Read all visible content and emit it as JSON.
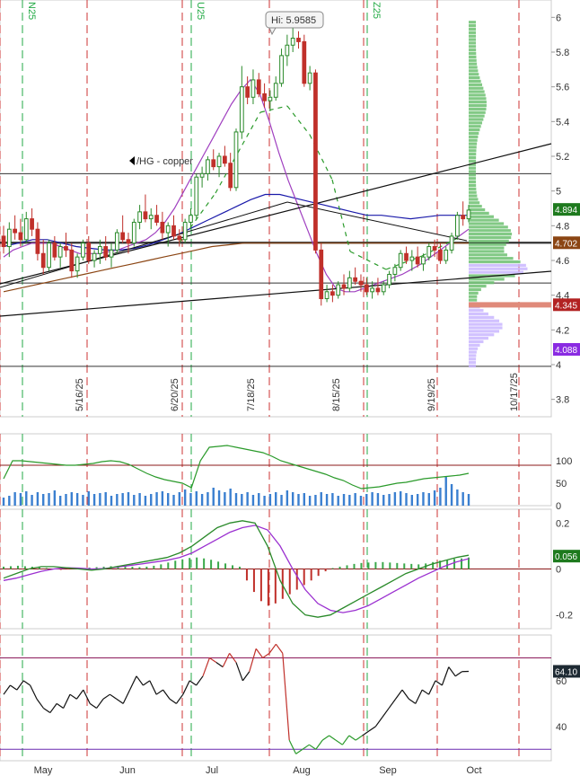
{
  "chart_data": {
    "type": "candlestick",
    "annotation_symbol": "/HG - copper",
    "hi_label": "Hi: 5.9585",
    "month_labels": [
      "May",
      "Jun",
      "Jul",
      "Aug",
      "Sep",
      "Oct"
    ],
    "date_labels": [
      "5/16/25",
      "6/20/25",
      "7/18/25",
      "8/15/25",
      "9/19/25",
      "10/17/25"
    ],
    "expiry_labels": [
      "N25",
      "U25",
      "Z25"
    ],
    "price_panel": {
      "ylim": [
        3.7,
        6.1
      ],
      "ticks": [
        "6",
        "5.8",
        "5.6",
        "5.4",
        "5.2",
        "5",
        "4.8",
        "4.6",
        "4.4",
        "4.2",
        "4",
        "3.8"
      ],
      "tick_values": [
        6,
        5.8,
        5.6,
        5.4,
        5.2,
        5,
        4.8,
        4.6,
        4.4,
        4.2,
        4,
        3.8
      ],
      "horizontal_lines": [
        5.1,
        4.702,
        4.47,
        3.99
      ],
      "badges": [
        {
          "label": "4.894",
          "value": 4.894,
          "color": "#1e7a1e"
        },
        {
          "label": "4.702",
          "value": 4.702,
          "color": "#8b4513"
        },
        {
          "label": "4.345",
          "value": 4.345,
          "color": "#b22222"
        },
        {
          "label": "4.088",
          "value": 4.088,
          "color": "#8a2be2"
        }
      ],
      "candles_ohlc": [
        [
          4.74,
          4.8,
          4.64,
          4.68
        ],
        [
          4.68,
          4.82,
          4.62,
          4.78
        ],
        [
          4.78,
          4.86,
          4.72,
          4.76
        ],
        [
          4.76,
          4.84,
          4.68,
          4.72
        ],
        [
          4.72,
          4.88,
          4.7,
          4.84
        ],
        [
          4.84,
          4.9,
          4.74,
          4.78
        ],
        [
          4.78,
          4.82,
          4.6,
          4.64
        ],
        [
          4.64,
          4.72,
          4.52,
          4.56
        ],
        [
          4.56,
          4.72,
          4.54,
          4.7
        ],
        [
          4.7,
          4.74,
          4.6,
          4.62
        ],
        [
          4.62,
          4.7,
          4.56,
          4.68
        ],
        [
          4.68,
          4.76,
          4.62,
          4.66
        ],
        [
          4.66,
          4.7,
          4.5,
          4.54
        ],
        [
          4.54,
          4.64,
          4.5,
          4.62
        ],
        [
          4.62,
          4.72,
          4.6,
          4.7
        ],
        [
          4.7,
          4.74,
          4.58,
          4.6
        ],
        [
          4.6,
          4.66,
          4.56,
          4.64
        ],
        [
          4.64,
          4.72,
          4.58,
          4.68
        ],
        [
          4.68,
          4.74,
          4.6,
          4.62
        ],
        [
          4.62,
          4.7,
          4.56,
          4.66
        ],
        [
          4.66,
          4.78,
          4.64,
          4.76
        ],
        [
          4.76,
          4.86,
          4.7,
          4.72
        ],
        [
          4.72,
          4.76,
          4.64,
          4.7
        ],
        [
          4.7,
          4.84,
          4.68,
          4.82
        ],
        [
          4.82,
          4.92,
          4.78,
          4.88
        ],
        [
          4.88,
          4.98,
          4.82,
          4.84
        ],
        [
          4.84,
          4.9,
          4.78,
          4.86
        ],
        [
          4.86,
          4.92,
          4.8,
          4.82
        ],
        [
          4.82,
          4.88,
          4.72,
          4.76
        ],
        [
          4.76,
          4.82,
          4.68,
          4.8
        ],
        [
          4.8,
          4.86,
          4.72,
          4.74
        ],
        [
          4.74,
          4.78,
          4.68,
          4.72
        ],
        [
          4.72,
          4.84,
          4.7,
          4.82
        ],
        [
          4.82,
          4.9,
          4.78,
          4.86
        ],
        [
          4.86,
          5.1,
          4.84,
          5.08
        ],
        [
          5.08,
          5.14,
          5.02,
          5.1
        ],
        [
          5.1,
          5.2,
          5.06,
          5.18
        ],
        [
          5.18,
          5.24,
          5.12,
          5.14
        ],
        [
          5.14,
          5.22,
          5.08,
          5.2
        ],
        [
          5.2,
          5.26,
          5.14,
          5.16
        ],
        [
          5.16,
          5.22,
          5.0,
          5.02
        ],
        [
          5.02,
          5.36,
          5.0,
          5.34
        ],
        [
          5.34,
          5.72,
          5.3,
          5.6
        ],
        [
          5.6,
          5.66,
          5.5,
          5.54
        ],
        [
          5.54,
          5.7,
          5.5,
          5.64
        ],
        [
          5.64,
          5.68,
          5.54,
          5.56
        ],
        [
          5.56,
          5.62,
          5.48,
          5.52
        ],
        [
          5.52,
          5.58,
          5.46,
          5.54
        ],
        [
          5.54,
          5.66,
          5.52,
          5.62
        ],
        [
          5.62,
          5.82,
          5.6,
          5.78
        ],
        [
          5.78,
          5.9,
          5.72,
          5.84
        ],
        [
          5.84,
          5.96,
          5.8,
          5.88
        ],
        [
          5.88,
          5.92,
          5.82,
          5.86
        ],
        [
          5.86,
          5.9,
          5.6,
          5.62
        ],
        [
          5.62,
          5.72,
          5.58,
          5.68
        ],
        [
          5.68,
          5.7,
          4.64,
          4.66
        ],
        [
          4.66,
          4.7,
          4.34,
          4.38
        ],
        [
          4.38,
          4.46,
          4.36,
          4.42
        ],
        [
          4.42,
          4.46,
          4.36,
          4.4
        ],
        [
          4.4,
          4.48,
          4.38,
          4.46
        ],
        [
          4.46,
          4.52,
          4.4,
          4.44
        ],
        [
          4.44,
          4.54,
          4.42,
          4.5
        ],
        [
          4.5,
          4.56,
          4.46,
          4.48
        ],
        [
          4.48,
          4.52,
          4.42,
          4.46
        ],
        [
          4.46,
          4.5,
          4.4,
          4.42
        ],
        [
          4.42,
          4.48,
          4.38,
          4.44
        ],
        [
          4.44,
          4.5,
          4.4,
          4.42
        ],
        [
          4.42,
          4.48,
          4.4,
          4.46
        ],
        [
          4.46,
          4.54,
          4.44,
          4.52
        ],
        [
          4.52,
          4.58,
          4.48,
          4.56
        ],
        [
          4.56,
          4.66,
          4.54,
          4.64
        ],
        [
          4.64,
          4.68,
          4.58,
          4.6
        ],
        [
          4.6,
          4.66,
          4.54,
          4.62
        ],
        [
          4.62,
          4.68,
          4.56,
          4.58
        ],
        [
          4.58,
          4.64,
          4.54,
          4.62
        ],
        [
          4.62,
          4.7,
          4.6,
          4.68
        ],
        [
          4.68,
          4.72,
          4.62,
          4.66
        ],
        [
          4.66,
          4.7,
          4.58,
          4.6
        ],
        [
          4.6,
          4.68,
          4.58,
          4.66
        ],
        [
          4.66,
          4.76,
          4.64,
          4.74
        ],
        [
          4.74,
          4.88,
          4.72,
          4.86
        ],
        [
          4.86,
          4.94,
          4.8,
          4.84
        ],
        [
          4.84,
          4.92,
          4.82,
          4.89
        ]
      ],
      "ma_short": [
        4.62,
        4.66,
        4.68,
        4.7,
        4.7,
        4.7,
        4.68,
        4.66,
        4.64,
        4.64,
        4.64,
        4.65,
        4.66,
        4.68,
        4.7,
        4.72,
        4.76,
        4.82,
        4.9,
        5.0,
        5.1,
        5.2,
        5.3,
        5.4,
        5.5,
        5.58,
        5.64,
        5.56,
        5.4,
        5.22,
        5.06,
        4.92,
        4.78,
        4.64,
        4.52,
        4.44,
        4.42,
        4.42,
        4.44,
        4.46,
        4.48,
        4.5,
        4.52,
        4.55,
        4.58,
        4.62,
        4.66,
        4.7,
        4.74,
        4.78
      ],
      "ma_mid": [
        4.68,
        4.7,
        4.72,
        4.72,
        4.7,
        4.68,
        4.67,
        4.66,
        4.66,
        4.67,
        4.69,
        4.72,
        4.75,
        4.79,
        4.83,
        4.87,
        4.91,
        4.95,
        4.98,
        4.98,
        4.96,
        4.94,
        4.92,
        4.9,
        4.88,
        4.86,
        4.86,
        4.85,
        4.84,
        4.85,
        4.86,
        4.86,
        4.86
      ],
      "ma_long": [
        4.42,
        4.44,
        4.46,
        4.48,
        4.5,
        4.52,
        4.54,
        4.56,
        4.58,
        4.6,
        4.62,
        4.64,
        4.66,
        4.68,
        4.69,
        4.7,
        4.7,
        4.7,
        4.7,
        4.7,
        4.7,
        4.7,
        4.7,
        4.7,
        4.7,
        4.7,
        4.7,
        4.7,
        4.7,
        4.7
      ]
    },
    "volume_panel": {
      "ylim": [
        0,
        160
      ],
      "ticks": [
        "100",
        "50",
        "0"
      ],
      "tick_values": [
        100,
        50,
        0
      ],
      "reference_line": 90,
      "bars": [
        18,
        22,
        30,
        28,
        32,
        24,
        30,
        26,
        28,
        34,
        22,
        26,
        30,
        28,
        24,
        32,
        26,
        28,
        30,
        22,
        26,
        28,
        30,
        24,
        28,
        22,
        26,
        30,
        32,
        28,
        24,
        30,
        36,
        28,
        32,
        26,
        30,
        40,
        34,
        30,
        38,
        28,
        26,
        30,
        24,
        28,
        22,
        26,
        30,
        24,
        34,
        30,
        26,
        28,
        22,
        24,
        30,
        26,
        28,
        22,
        26,
        24,
        28,
        22,
        26,
        30,
        28,
        24,
        26,
        30,
        32,
        28,
        24,
        26,
        30,
        28,
        34,
        40,
        66,
        48,
        36,
        30,
        26
      ],
      "open_interest": [
        60,
        100,
        100,
        98,
        96,
        94,
        92,
        90,
        90,
        92,
        94,
        98,
        100,
        98,
        92,
        82,
        72,
        64,
        58,
        54,
        50,
        40,
        100,
        130,
        132,
        134,
        130,
        126,
        122,
        118,
        110,
        100,
        94,
        88,
        82,
        76,
        70,
        62,
        56,
        46,
        38,
        40,
        42,
        46,
        50,
        52,
        56,
        60,
        62,
        64,
        66,
        68,
        72
      ]
    },
    "macd_panel": {
      "ylim": [
        -0.26,
        0.26
      ],
      "ticks": [
        "0.2",
        "0",
        "-0.2"
      ],
      "tick_values": [
        0.2,
        0,
        -0.2
      ],
      "badge": {
        "label": "0.056",
        "value": 0.056,
        "color": "#1e7a1e"
      },
      "histogram": [
        0.01,
        0.012,
        0.014,
        0.012,
        0.01,
        0.008,
        0.004,
        0,
        -0.004,
        -0.002,
        0.002,
        0.004,
        0.006,
        0.008,
        0.01,
        0.012,
        0.014,
        0.012,
        0.01,
        0.008,
        0.01,
        0.014,
        0.02,
        0.028,
        0.036,
        0.042,
        0.048,
        0.05,
        0.046,
        0.04,
        0.032,
        0.024,
        0.016,
        0.01,
        -0.05,
        -0.1,
        -0.14,
        -0.16,
        -0.15,
        -0.13,
        -0.11,
        -0.09,
        -0.07,
        -0.05,
        -0.03,
        -0.01,
        0.004,
        0.01,
        0.016,
        0.022,
        0.026,
        0.028,
        0.03,
        0.03,
        0.028,
        0.026,
        0.024,
        0.022,
        0.02,
        0.024,
        0.03,
        0.036,
        0.04,
        0.044,
        0.046,
        0.05
      ],
      "macd_line": [
        -0.04,
        -0.02,
        0.0,
        0.01,
        0.01,
        0.005,
        0.0,
        -0.005,
        0.0,
        0.01,
        0.02,
        0.03,
        0.04,
        0.05,
        0.07,
        0.1,
        0.14,
        0.18,
        0.2,
        0.21,
        0.2,
        0.1,
        -0.05,
        -0.15,
        -0.2,
        -0.21,
        -0.2,
        -0.17,
        -0.14,
        -0.11,
        -0.08,
        -0.05,
        -0.02,
        0.0,
        0.02,
        0.035,
        0.05,
        0.06
      ],
      "signal_line": [
        -0.05,
        -0.04,
        -0.025,
        -0.01,
        0.0,
        0.005,
        0.004,
        0.0,
        0.002,
        0.008,
        0.015,
        0.022,
        0.03,
        0.038,
        0.05,
        0.07,
        0.1,
        0.13,
        0.16,
        0.18,
        0.19,
        0.17,
        0.1,
        0.0,
        -0.09,
        -0.15,
        -0.18,
        -0.19,
        -0.18,
        -0.16,
        -0.13,
        -0.1,
        -0.07,
        -0.04,
        -0.015,
        0.01,
        0.03,
        0.045
      ]
    },
    "rsi_panel": {
      "ylim": [
        25,
        80
      ],
      "ticks": [
        "60",
        "40"
      ],
      "tick_values": [
        60,
        40
      ],
      "upper_line": 70,
      "lower_line": 30,
      "badge": {
        "label": "64.10",
        "value": 64.1,
        "color": "#1e2a33"
      },
      "values": [
        54,
        58,
        56,
        60,
        58,
        52,
        48,
        46,
        50,
        48,
        54,
        52,
        56,
        50,
        48,
        52,
        54,
        52,
        50,
        56,
        62,
        58,
        60,
        54,
        56,
        52,
        50,
        54,
        60,
        58,
        62,
        70,
        68,
        66,
        72,
        68,
        60,
        64,
        74,
        70,
        72,
        76,
        72,
        34,
        28,
        30,
        32,
        30,
        34,
        36,
        34,
        32,
        36,
        34,
        36,
        38,
        40,
        44,
        48,
        52,
        56,
        52,
        50,
        56,
        54,
        60,
        58,
        66,
        62,
        64,
        64.1
      ]
    }
  }
}
